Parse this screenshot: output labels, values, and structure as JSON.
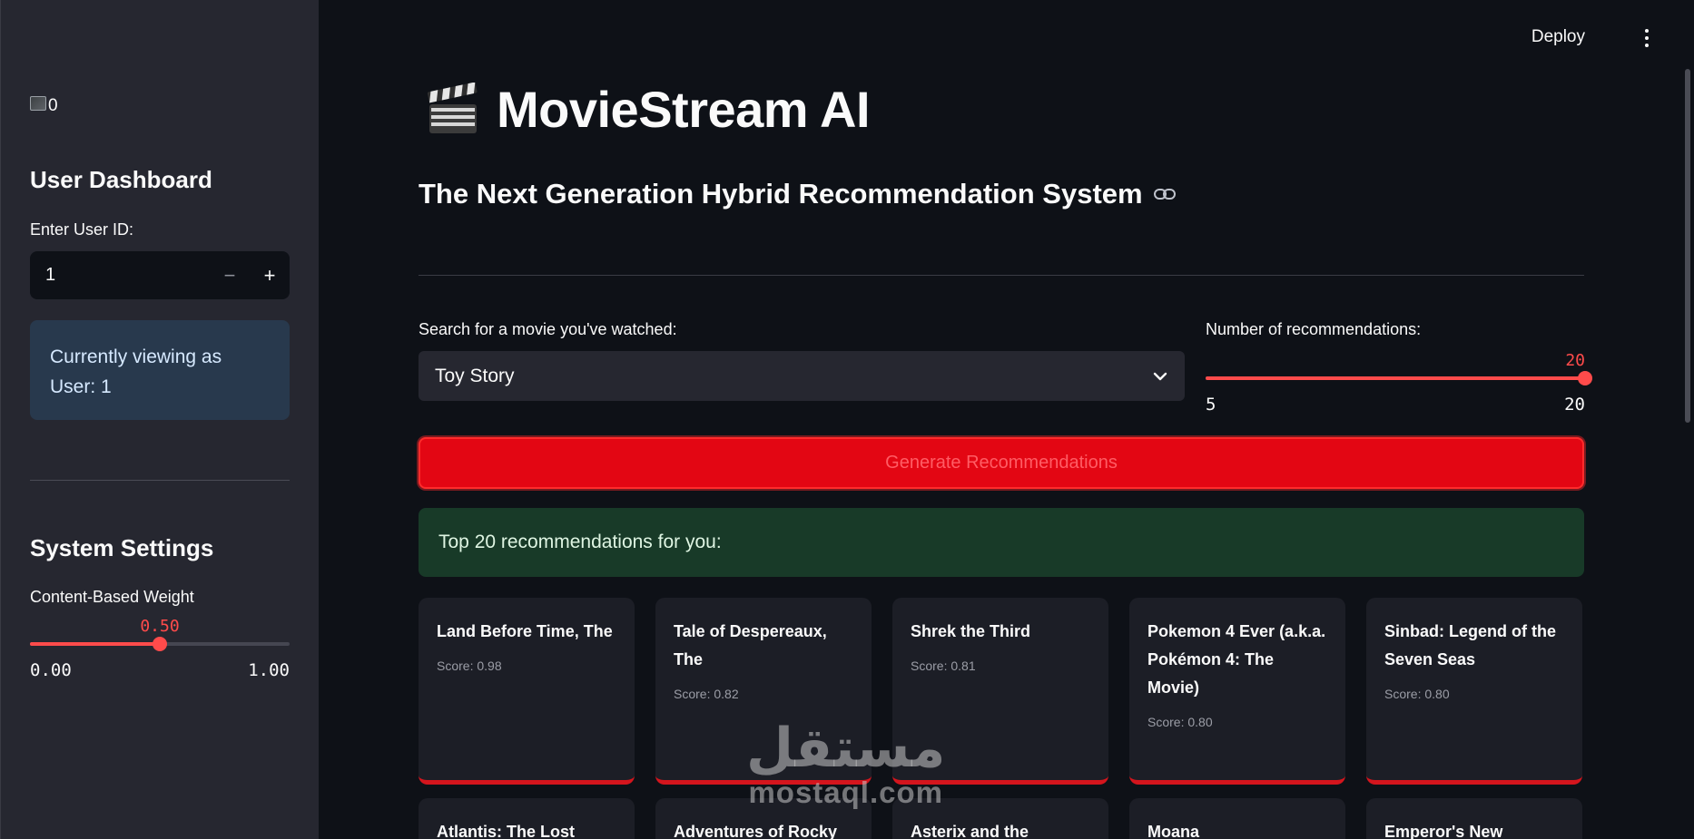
{
  "sidebar": {
    "image_alt": "0",
    "dashboard_title": "User Dashboard",
    "user_id_label": "Enter User ID:",
    "user_id_value": "1",
    "minus_glyph": "−",
    "plus_glyph": "+",
    "info_text": "Currently viewing as User: 1",
    "settings_title": "System Settings",
    "weight_label": "Content-Based Weight",
    "weight": {
      "value": 0.5,
      "value_text": "0.50",
      "min_text": "0.00",
      "max_text": "1.00",
      "min": 0,
      "max": 1
    }
  },
  "header": {
    "deploy_label": "Deploy",
    "menu_icon": "kebab-menu-icon"
  },
  "main": {
    "title": "MovieStream AI",
    "title_icon": "clapper-board-icon",
    "subtitle": "The Next Generation Hybrid Recommendation System",
    "subtitle_icon": "link-icon",
    "search_label": "Search for a movie you've watched:",
    "search_value": "Toy Story",
    "num_label": "Number of recommendations:",
    "num_slider": {
      "value": 20,
      "value_text": "20",
      "min_text": "5",
      "max_text": "20",
      "min": 5,
      "max": 20
    },
    "generate_label": "Generate Recommendations",
    "success_text": "Top 20 recommendations for you:",
    "cards": [
      {
        "title": "Land Before Time, The",
        "score": "Score: 0.98"
      },
      {
        "title": "Tale of Despereaux, The",
        "score": "Score: 0.82"
      },
      {
        "title": "Shrek the Third",
        "score": "Score: 0.81"
      },
      {
        "title": "Pokemon 4 Ever (a.k.a. Pokémon 4: The Movie)",
        "score": "Score: 0.80"
      },
      {
        "title": "Sinbad: Legend of the Seven Seas",
        "score": "Score: 0.80"
      }
    ],
    "cards_row2": [
      {
        "title": "Atlantis: The Lost"
      },
      {
        "title": "Adventures of Rocky"
      },
      {
        "title": "Asterix and the Vikings"
      },
      {
        "title": "Moana"
      },
      {
        "title": "Emperor's New"
      }
    ]
  },
  "watermark": {
    "arabic": "مستقل",
    "latin": "mostaql.com"
  },
  "colors": {
    "accent": "#ff4b4b",
    "button": "#e30613",
    "success_bg": "#183a28",
    "info_bg": "#28394d"
  }
}
